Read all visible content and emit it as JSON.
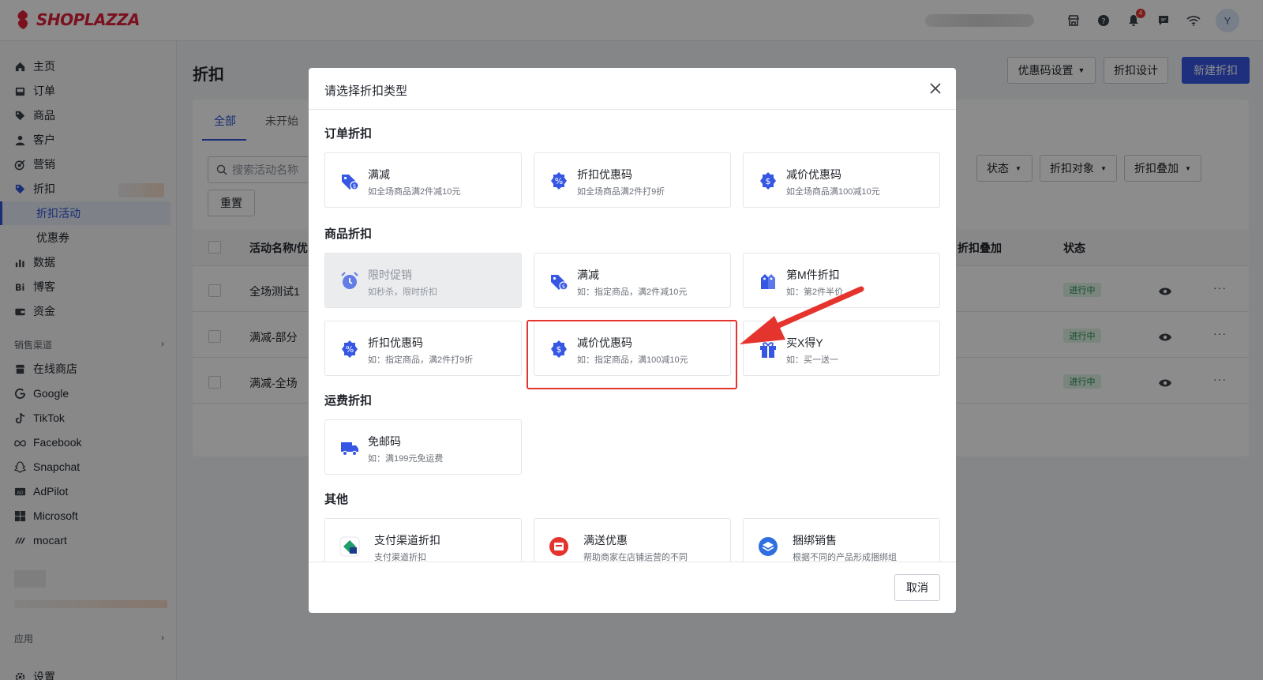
{
  "app": {
    "logo_text": "SHOPLAZZA",
    "brand_color": "#e0203a",
    "accent_color": "#3557e3"
  },
  "topbar": {
    "notification_count": "4",
    "avatar_letter": "Y"
  },
  "sidebar": {
    "items": [
      {
        "label": "主页",
        "icon": "home-icon"
      },
      {
        "label": "订单",
        "icon": "orders-icon"
      },
      {
        "label": "商品",
        "icon": "tag-icon"
      },
      {
        "label": "客户",
        "icon": "user-icon"
      },
      {
        "label": "营销",
        "icon": "target-icon"
      },
      {
        "label": "折扣",
        "icon": "discount-icon"
      }
    ],
    "sub_items": [
      {
        "label": "折扣活动"
      },
      {
        "label": "优惠券"
      }
    ],
    "items2": [
      {
        "label": "数据",
        "icon": "bar-chart-icon"
      },
      {
        "label": "博客",
        "icon": "blog-icon"
      },
      {
        "label": "资金",
        "icon": "wallet-icon"
      }
    ],
    "channels_label": "销售渠道",
    "channels": [
      {
        "label": "在线商店",
        "icon": "store-icon"
      },
      {
        "label": "Google",
        "icon": "google-icon"
      },
      {
        "label": "TikTok",
        "icon": "tiktok-icon"
      },
      {
        "label": "Facebook",
        "icon": "meta-icon"
      },
      {
        "label": "Snapchat",
        "icon": "snapchat-icon"
      },
      {
        "label": "AdPilot",
        "icon": "ad-icon"
      },
      {
        "label": "Microsoft",
        "icon": "microsoft-icon"
      },
      {
        "label": "mocart",
        "icon": "mocart-icon"
      }
    ],
    "apps_label": "应用",
    "settings_label": "设置"
  },
  "main": {
    "title": "折扣",
    "buttons": {
      "coupon_settings": "优惠码设置",
      "discount_design": "折扣设计",
      "new_discount": "新建折扣"
    },
    "tabs": [
      "全部",
      "未开始"
    ],
    "search_placeholder": "搜索活动名称",
    "reset": "重置",
    "filters": [
      "状态",
      "折扣对象",
      "折扣叠加"
    ],
    "columns": {
      "name": "活动名称/优",
      "stacking": "折扣叠加",
      "status": "状态"
    },
    "rows": [
      {
        "name": "全场测试1",
        "status": "进行中"
      },
      {
        "name": "满减-部分",
        "status": "进行中"
      },
      {
        "name": "满减-全场",
        "status": "进行中"
      }
    ]
  },
  "modal": {
    "title": "请选择折扣类型",
    "sections": {
      "order": "订单折扣",
      "product": "商品折扣",
      "shipping": "运费折扣",
      "other": "其他"
    },
    "order_options": [
      {
        "title": "满减",
        "desc": "如全场商品满2件减10元",
        "icon": "tag-dollar-icon"
      },
      {
        "title": "折扣优惠码",
        "desc": "如全场商品满2件打9折",
        "icon": "percent-badge-icon"
      },
      {
        "title": "减价优惠码",
        "desc": "如全场商品满100减10元",
        "icon": "dollar-badge-icon"
      }
    ],
    "product_options": [
      {
        "title": "限时促销",
        "desc": "如秒杀，限时折扣",
        "icon": "alarm-clock-icon",
        "disabled": true
      },
      {
        "title": "满减",
        "desc": "如：指定商品，满2件减10元",
        "icon": "tag-dollar-icon"
      },
      {
        "title": "第M件折扣",
        "desc": "如：第2件半价",
        "icon": "tags-icon"
      },
      {
        "title": "折扣优惠码",
        "desc": "如：指定商品，满2件打9折",
        "icon": "percent-badge-icon"
      },
      {
        "title": "减价优惠码",
        "desc": "如：指定商品，满100减10元",
        "icon": "dollar-badge-icon"
      },
      {
        "title": "买X得Y",
        "desc": "如：买一送一",
        "icon": "gift-icon"
      }
    ],
    "shipping_options": [
      {
        "title": "免邮码",
        "desc": "如：满199元免运费",
        "icon": "truck-icon"
      }
    ],
    "other_options": [
      {
        "title": "支付渠道折扣",
        "desc": "支付渠道折扣",
        "icon": "payment-app-icon"
      },
      {
        "title": "满送优惠",
        "desc": "帮助商家在店铺运营的不同",
        "icon": "gift-app-icon"
      },
      {
        "title": "捆绑销售",
        "desc": "根据不同的产品形成捆绑组",
        "icon": "bundle-app-icon"
      }
    ],
    "cancel": "取消"
  }
}
